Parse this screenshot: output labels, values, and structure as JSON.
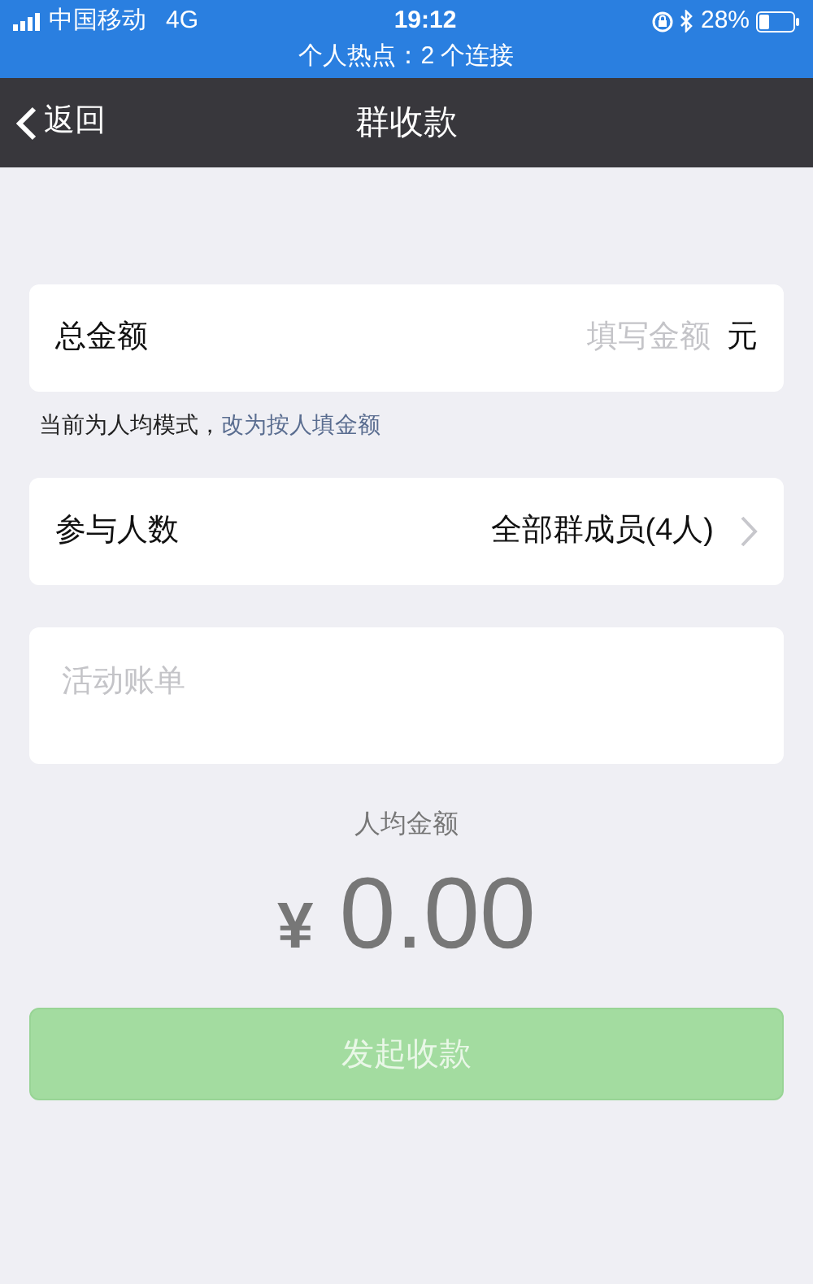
{
  "status_bar": {
    "carrier": "中国移动",
    "network": "4G",
    "time": "19:12",
    "battery": "28%",
    "hotspot": "个人热点：2 个连接"
  },
  "nav": {
    "back": "返回",
    "title": "群收款"
  },
  "total": {
    "label": "总金额",
    "placeholder": "填写金额",
    "unit": "元"
  },
  "mode_hint": {
    "text": "当前为人均模式，",
    "link": "改为按人填金额"
  },
  "participants": {
    "label": "参与人数",
    "value": "全部群成员(4人)"
  },
  "bill": {
    "placeholder": "活动账单"
  },
  "per_person": {
    "label": "人均金额",
    "currency": "¥",
    "amount": "0.00"
  },
  "submit": {
    "label": "发起收款",
    "disabled": true
  }
}
